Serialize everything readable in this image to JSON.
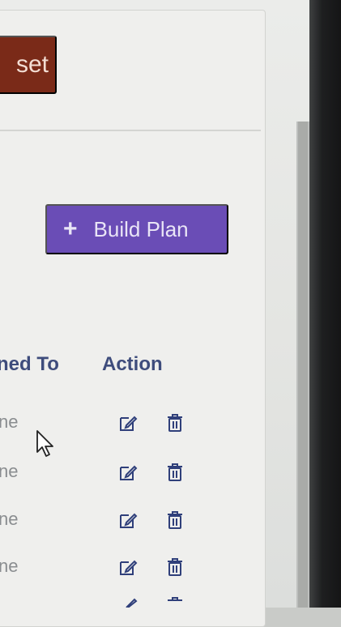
{
  "toolbar": {
    "reset_label": "set"
  },
  "main": {
    "build_plan_label": "Build Plan"
  },
  "table": {
    "headers": {
      "assigned": "ned To",
      "action": "Action"
    },
    "rows": [
      {
        "assigned": "ne"
      },
      {
        "assigned": "ne"
      },
      {
        "assigned": "ne"
      },
      {
        "assigned": "ne"
      }
    ]
  },
  "colors": {
    "reset_bg": "#7a2a18",
    "build_bg": "#6a4db6",
    "header_text": "#3e4c7c",
    "icon": "#2f3f7a"
  },
  "icons": [
    "plus-icon",
    "edit-icon",
    "trash-icon",
    "mouse-cursor-icon"
  ]
}
